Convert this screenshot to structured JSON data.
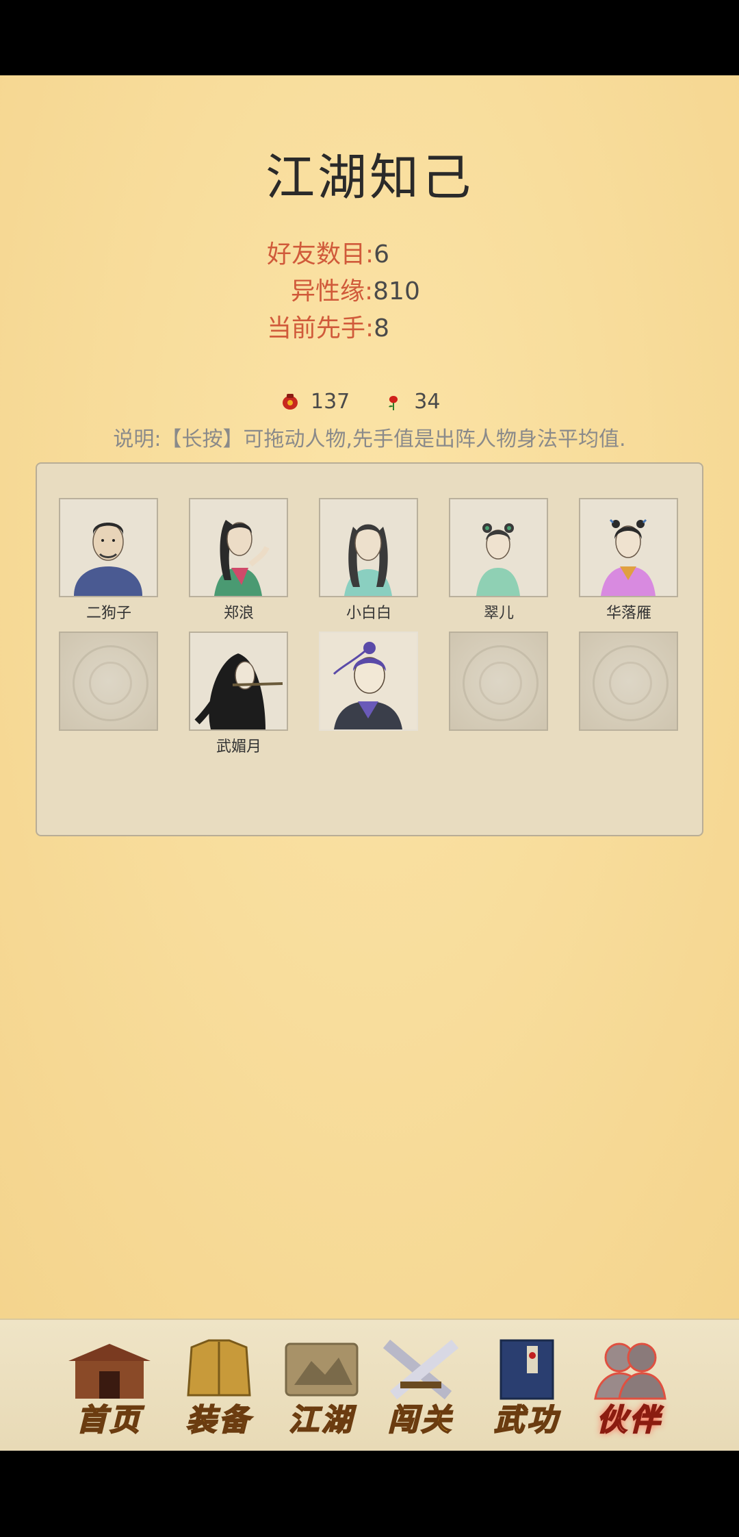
{
  "title": "江湖知己",
  "stats": [
    {
      "label": "好友数目:",
      "value": "6"
    },
    {
      "label": "异性缘:",
      "value": "810"
    },
    {
      "label": "当前先手:",
      "value": "8"
    }
  ],
  "currency": [
    {
      "icon": "jar-icon",
      "value": "137"
    },
    {
      "icon": "rose-icon",
      "value": "34"
    }
  ],
  "note": "说明:【长按】可拖动人物,先手值是出阵人物身法平均值.",
  "partners": [
    {
      "name": "二狗子"
    },
    {
      "name": "郑浪"
    },
    {
      "name": "小白白"
    },
    {
      "name": "翠儿"
    },
    {
      "name": "华落雁"
    },
    {
      "name": ""
    },
    {
      "name": "武媚月"
    },
    {
      "name": ""
    },
    {
      "name": ""
    },
    {
      "name": ""
    }
  ],
  "nav": [
    {
      "label": "首页",
      "icon": "house-icon"
    },
    {
      "label": "装备",
      "icon": "armor-icon"
    },
    {
      "label": "江湖",
      "icon": "scroll-map-icon"
    },
    {
      "label": "闯关",
      "icon": "crossed-swords-icon"
    },
    {
      "label": "武功",
      "icon": "book-icon"
    },
    {
      "label": "伙伴",
      "icon": "partners-icon",
      "active": true
    }
  ],
  "colors": {
    "accent_red": "#d05a3a",
    "background": "#f8dd9c",
    "panel": "#e8dcc0"
  }
}
